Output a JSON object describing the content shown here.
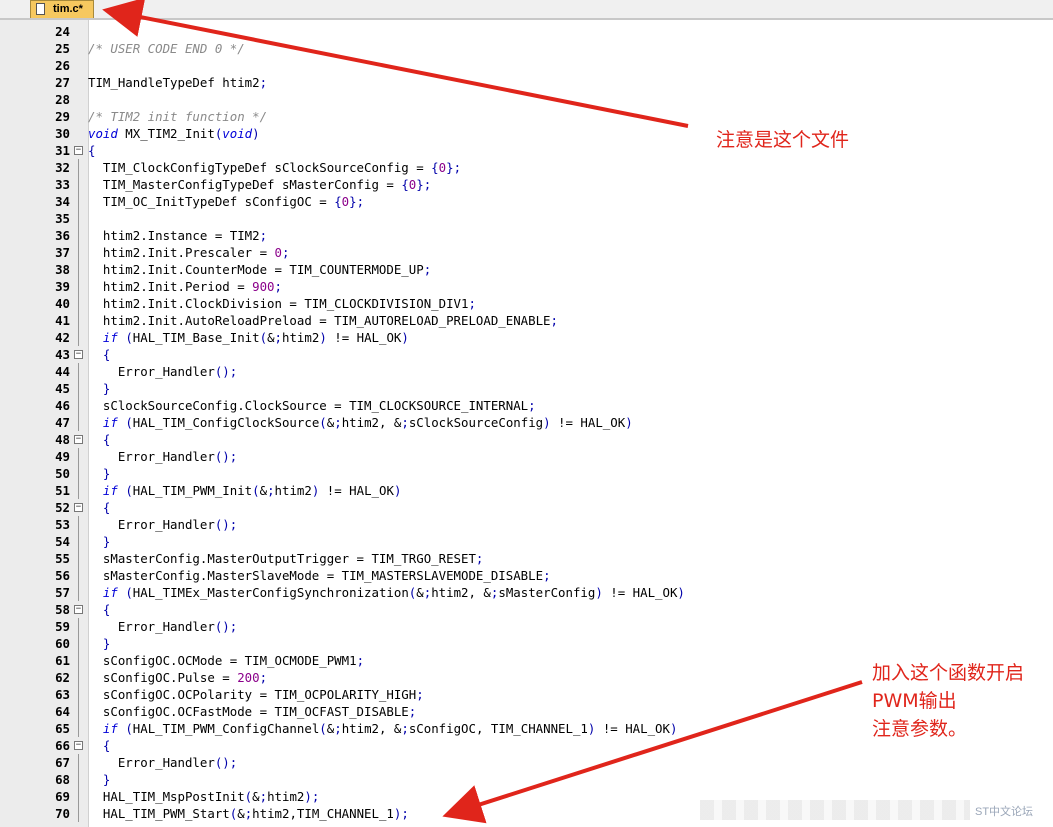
{
  "tab": {
    "label": "tim.c*"
  },
  "code_lines": [
    {
      "n": "24",
      "fold": "",
      "t": ""
    },
    {
      "n": "25",
      "fold": "",
      "t": "/* USER CODE END 0 */"
    },
    {
      "n": "26",
      "fold": "",
      "t": ""
    },
    {
      "n": "27",
      "fold": "",
      "t": "TIM_HandleTypeDef htim2;"
    },
    {
      "n": "28",
      "fold": "",
      "t": ""
    },
    {
      "n": "29",
      "fold": "",
      "t": "/* TIM2 init function */"
    },
    {
      "n": "30",
      "fold": "",
      "t": "void MX_TIM2_Init(void)"
    },
    {
      "n": "31",
      "fold": "open",
      "t": "{"
    },
    {
      "n": "32",
      "fold": "line",
      "t": "  TIM_ClockConfigTypeDef sClockSourceConfig = {0};"
    },
    {
      "n": "33",
      "fold": "line",
      "t": "  TIM_MasterConfigTypeDef sMasterConfig = {0};"
    },
    {
      "n": "34",
      "fold": "line",
      "t": "  TIM_OC_InitTypeDef sConfigOC = {0};"
    },
    {
      "n": "35",
      "fold": "line",
      "t": ""
    },
    {
      "n": "36",
      "fold": "line",
      "t": "  htim2.Instance = TIM2;"
    },
    {
      "n": "37",
      "fold": "line",
      "t": "  htim2.Init.Prescaler = 0;"
    },
    {
      "n": "38",
      "fold": "line",
      "t": "  htim2.Init.CounterMode = TIM_COUNTERMODE_UP;"
    },
    {
      "n": "39",
      "fold": "line",
      "t": "  htim2.Init.Period = 900;"
    },
    {
      "n": "40",
      "fold": "line",
      "t": "  htim2.Init.ClockDivision = TIM_CLOCKDIVISION_DIV1;"
    },
    {
      "n": "41",
      "fold": "line",
      "t": "  htim2.Init.AutoReloadPreload = TIM_AUTORELOAD_PRELOAD_ENABLE;"
    },
    {
      "n": "42",
      "fold": "line",
      "t": "  if (HAL_TIM_Base_Init(&htim2) != HAL_OK)"
    },
    {
      "n": "43",
      "fold": "open",
      "t": "  {"
    },
    {
      "n": "44",
      "fold": "line",
      "t": "    Error_Handler();"
    },
    {
      "n": "45",
      "fold": "line",
      "t": "  }"
    },
    {
      "n": "46",
      "fold": "line",
      "t": "  sClockSourceConfig.ClockSource = TIM_CLOCKSOURCE_INTERNAL;"
    },
    {
      "n": "47",
      "fold": "line",
      "t": "  if (HAL_TIM_ConfigClockSource(&htim2, &sClockSourceConfig) != HAL_OK)"
    },
    {
      "n": "48",
      "fold": "open",
      "t": "  {"
    },
    {
      "n": "49",
      "fold": "line",
      "t": "    Error_Handler();"
    },
    {
      "n": "50",
      "fold": "line",
      "t": "  }"
    },
    {
      "n": "51",
      "fold": "line",
      "t": "  if (HAL_TIM_PWM_Init(&htim2) != HAL_OK)"
    },
    {
      "n": "52",
      "fold": "open",
      "t": "  {"
    },
    {
      "n": "53",
      "fold": "line",
      "t": "    Error_Handler();"
    },
    {
      "n": "54",
      "fold": "line",
      "t": "  }"
    },
    {
      "n": "55",
      "fold": "line",
      "t": "  sMasterConfig.MasterOutputTrigger = TIM_TRGO_RESET;"
    },
    {
      "n": "56",
      "fold": "line",
      "t": "  sMasterConfig.MasterSlaveMode = TIM_MASTERSLAVEMODE_DISABLE;"
    },
    {
      "n": "57",
      "fold": "line",
      "t": "  if (HAL_TIMEx_MasterConfigSynchronization(&htim2, &sMasterConfig) != HAL_OK)"
    },
    {
      "n": "58",
      "fold": "open",
      "t": "  {"
    },
    {
      "n": "59",
      "fold": "line",
      "t": "    Error_Handler();"
    },
    {
      "n": "60",
      "fold": "line",
      "t": "  }"
    },
    {
      "n": "61",
      "fold": "line",
      "t": "  sConfigOC.OCMode = TIM_OCMODE_PWM1;"
    },
    {
      "n": "62",
      "fold": "line",
      "t": "  sConfigOC.Pulse = 200;"
    },
    {
      "n": "63",
      "fold": "line",
      "t": "  sConfigOC.OCPolarity = TIM_OCPOLARITY_HIGH;"
    },
    {
      "n": "64",
      "fold": "line",
      "t": "  sConfigOC.OCFastMode = TIM_OCFAST_DISABLE;"
    },
    {
      "n": "65",
      "fold": "line",
      "t": "  if (HAL_TIM_PWM_ConfigChannel(&htim2, &sConfigOC, TIM_CHANNEL_1) != HAL_OK)"
    },
    {
      "n": "66",
      "fold": "open",
      "t": "  {"
    },
    {
      "n": "67",
      "fold": "line",
      "t": "    Error_Handler();"
    },
    {
      "n": "68",
      "fold": "line",
      "t": "  }"
    },
    {
      "n": "69",
      "fold": "line",
      "t": "  HAL_TIM_MspPostInit(&htim2);"
    },
    {
      "n": "70",
      "fold": "line",
      "t": "  HAL_TIM_PWM_Start(&htim2,TIM_CHANNEL_1);"
    }
  ],
  "annotations": {
    "file_note": "注意是这个文件",
    "func_note_1": "加入这个函数开启",
    "func_note_2": "PWM输出",
    "func_note_3": "注意参数。"
  },
  "watermark": "ST中文论坛",
  "colors": {
    "annotation": "#e0251b",
    "keyword": "#0000d8",
    "comment": "#8a8a8a",
    "number": "#8b008b",
    "tab": "#f6c85f"
  }
}
